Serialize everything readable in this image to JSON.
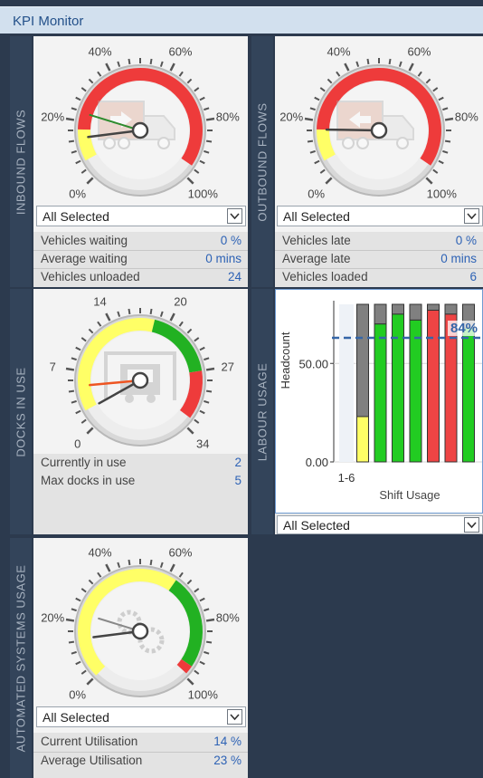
{
  "app": {
    "title": "KPI Monitor"
  },
  "panels": {
    "inbound": {
      "label": "INBOUND FLOWS",
      "gauge": {
        "ticks": [
          "0%",
          "20%",
          "40%",
          "60%",
          "80%",
          "100%"
        ],
        "value_pct": 14,
        "average_pct": 23,
        "icon": "truck-inbound-icon"
      },
      "filter": "All Selected",
      "stats": [
        {
          "label": "Vehicles waiting",
          "value": "0 %"
        },
        {
          "label": "Average waiting",
          "value": "0 mins"
        },
        {
          "label": "Vehicles unloaded",
          "value": "24"
        }
      ]
    },
    "outbound": {
      "label": "OUTBOUND FLOWS",
      "gauge": {
        "ticks": [
          "0%",
          "20%",
          "40%",
          "60%",
          "80%",
          "100%"
        ],
        "value_pct": 17,
        "average_pct": 23,
        "icon": "truck-outbound-icon"
      },
      "filter": "All Selected",
      "stats": [
        {
          "label": "Vehicles late",
          "value": "0 %"
        },
        {
          "label": "Average late",
          "value": "0 mins"
        },
        {
          "label": "Vehicles loaded",
          "value": "6"
        }
      ]
    },
    "docks": {
      "label": "DOCKS IN USE",
      "gauge": {
        "ticks": [
          "0",
          "7",
          "14",
          "20",
          "27",
          "34"
        ],
        "value": 2,
        "max": 5,
        "icon": "dock-truck-icon"
      },
      "stats": [
        {
          "label": "Currently in use",
          "value": "2"
        },
        {
          "label": "Max docks in use",
          "value": "5"
        }
      ]
    },
    "labour": {
      "label": "LABOUR USAGE",
      "filter": "All Selected"
    },
    "automated": {
      "label": "AUTOMATED SYSTEMS USAGE",
      "gauge": {
        "ticks": [
          "0%",
          "20%",
          "40%",
          "60%",
          "80%",
          "100%"
        ],
        "value_pct": 14,
        "average_pct": 23,
        "icon": "gears-icon"
      },
      "filter": "All Selected",
      "stats": [
        {
          "label": "Current Utilisation",
          "value": "14 %"
        },
        {
          "label": "Average Utilisation",
          "value": "23 %"
        }
      ]
    }
  },
  "chart_data": {
    "type": "bar",
    "ylabel": "Headcount",
    "xlabel": "Shift Usage",
    "categories": [
      "1-6",
      "",
      "",
      "",
      "",
      "",
      "",
      ""
    ],
    "yticks": [
      "0.00",
      "50.00"
    ],
    "ylim": [
      0,
      80
    ],
    "target_label": "84%",
    "target_value": 63,
    "stack_total": 80,
    "series": [
      {
        "values": [
          0,
          23,
          70,
          75,
          72,
          77,
          75,
          68
        ],
        "colors": [
          "#ffffff",
          "#ffff66",
          "#22cc22",
          "#22cc22",
          "#22cc22",
          "#ee4444",
          "#ee4444",
          "#22cc22"
        ]
      }
    ],
    "colors": {
      "remainder": "#808080",
      "bar_outline": "#333333"
    }
  }
}
